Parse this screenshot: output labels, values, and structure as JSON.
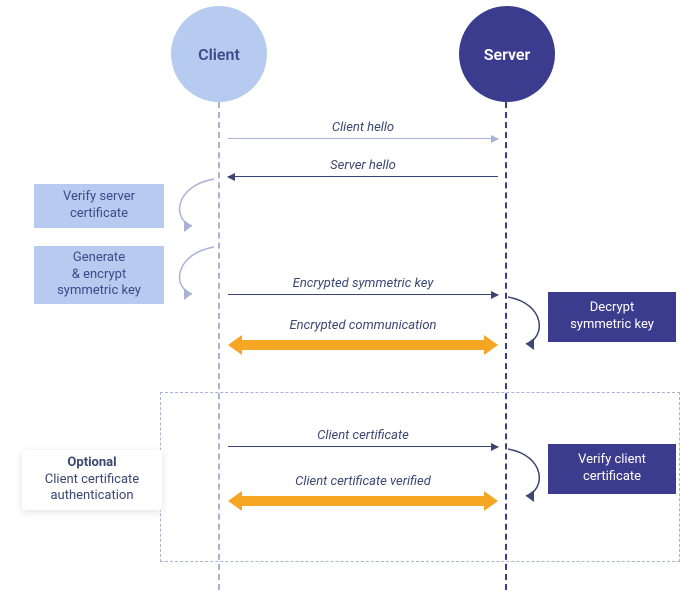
{
  "actors": {
    "client": "Client",
    "server": "Server"
  },
  "messages": {
    "client_hello": "Client hello",
    "server_hello": "Server hello",
    "encrypted_key": "Encrypted symmetric key",
    "encrypted_comm": "Encrypted communication",
    "client_cert": "Client certificate",
    "client_cert_verified": "Client certificate verified"
  },
  "steps": {
    "verify_server": {
      "line1": "Verify server",
      "line2": "certificate"
    },
    "gen_key": {
      "line1": "Generate",
      "line2": "& encrypt",
      "line3": "symmetric key"
    },
    "decrypt_key": {
      "line1": "Decrypt",
      "line2": "symmetric key"
    },
    "verify_client": {
      "line1": "Verify client",
      "line2": "certificate"
    },
    "optional": {
      "title": "Optional",
      "line1": "Client certificate",
      "line2": "authentication"
    }
  },
  "chart_data": {
    "type": "sequence_diagram",
    "actors": [
      "Client",
      "Server"
    ],
    "steps": [
      {
        "from": "Client",
        "to": "Server",
        "label": "Client hello"
      },
      {
        "from": "Server",
        "to": "Client",
        "label": "Server hello"
      },
      {
        "at": "Client",
        "action": "Verify server certificate"
      },
      {
        "at": "Client",
        "action": "Generate & encrypt symmetric key"
      },
      {
        "from": "Client",
        "to": "Server",
        "label": "Encrypted symmetric key"
      },
      {
        "at": "Server",
        "action": "Decrypt symmetric key"
      },
      {
        "between": [
          "Client",
          "Server"
        ],
        "label": "Encrypted communication",
        "bidirectional": true
      }
    ],
    "optional_block": {
      "label": "Optional — Client certificate authentication",
      "steps": [
        {
          "from": "Client",
          "to": "Server",
          "label": "Client certificate"
        },
        {
          "at": "Server",
          "action": "Verify client certificate"
        },
        {
          "between": [
            "Client",
            "Server"
          ],
          "label": "Client certificate verified",
          "bidirectional": true
        }
      ]
    }
  }
}
